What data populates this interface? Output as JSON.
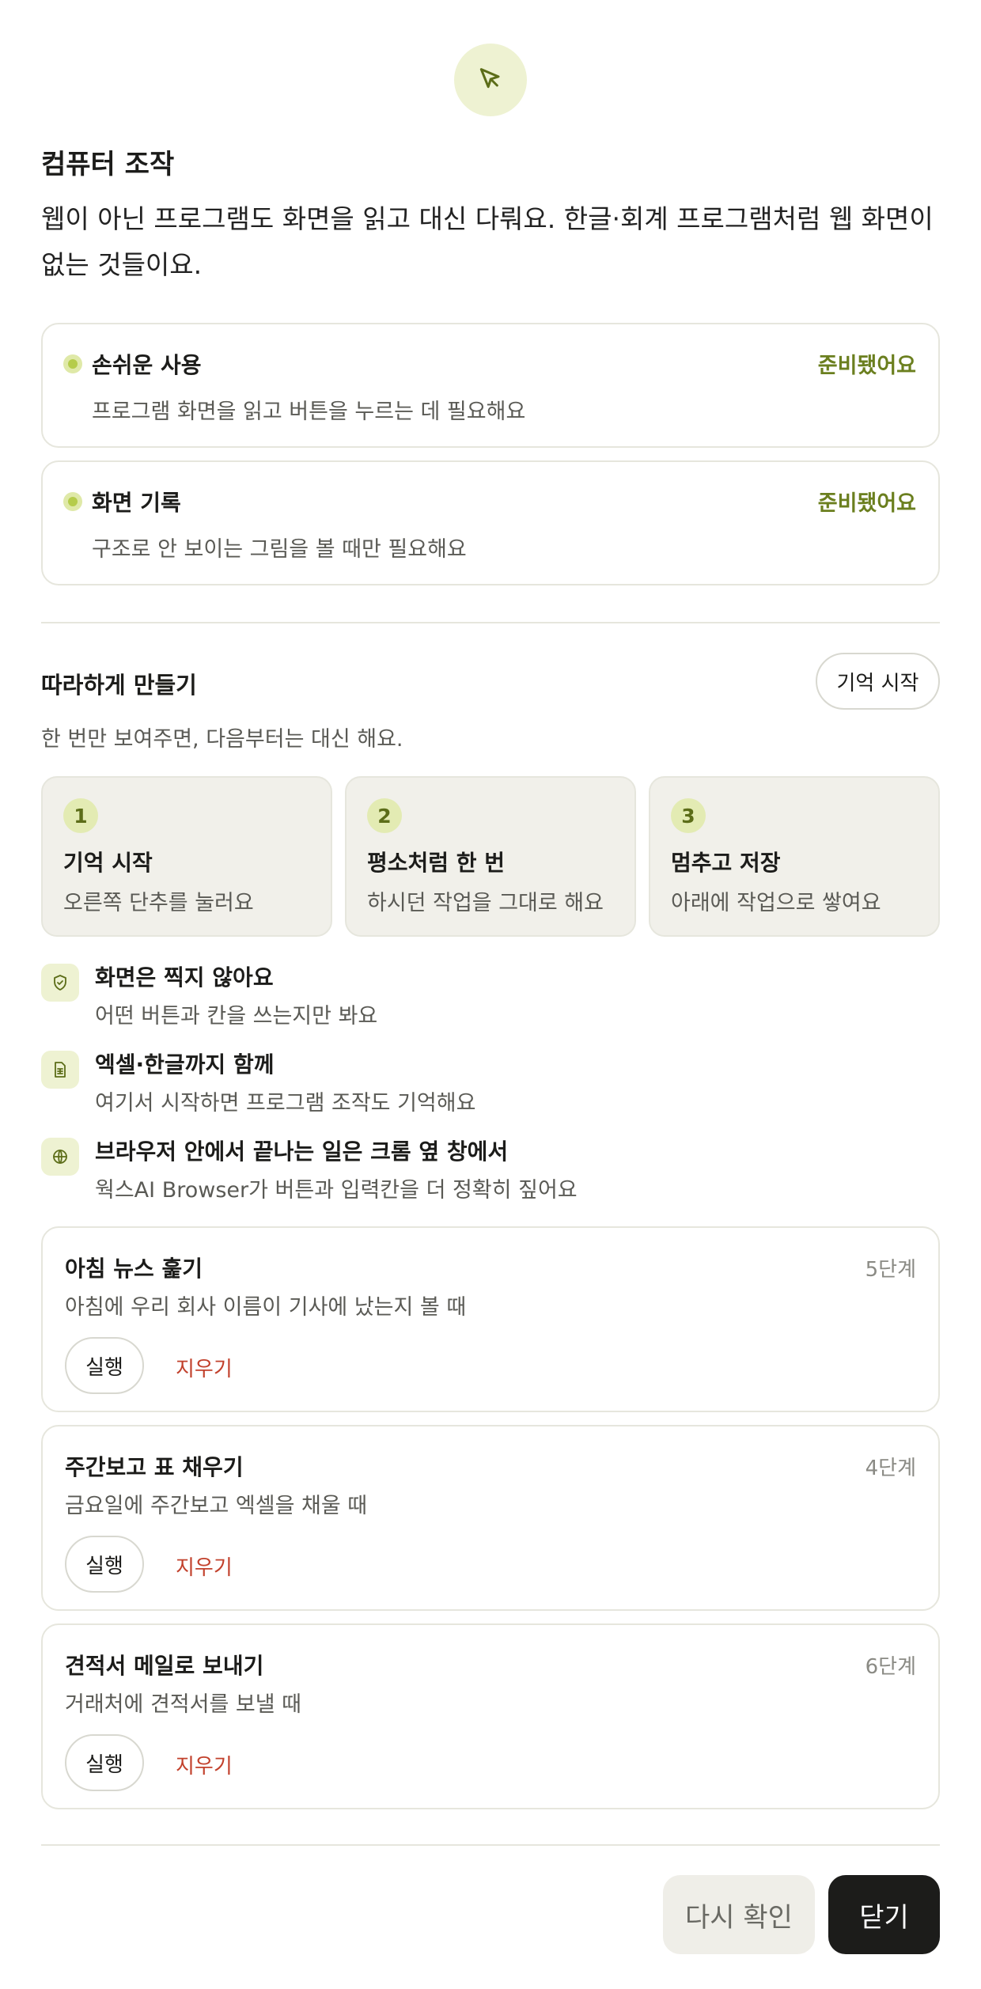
{
  "header": {
    "icon": "cursor-arrow-icon",
    "title": "컴퓨터 조작",
    "description": "웹이 아닌 프로그램도 화면을 읽고 대신 다뤄요. 한글·회계 프로그램처럼 웹 화면이 없는 것들이요."
  },
  "permissions": [
    {
      "name": "손쉬운 사용",
      "status": "준비됐어요",
      "description": "프로그램 화면을 읽고 버튼을 누르는 데 필요해요"
    },
    {
      "name": "화면 기록",
      "status": "준비됐어요",
      "description": "구조로 안 보이는 그림을 볼 때만 필요해요"
    }
  ],
  "teach": {
    "title": "따라하게 만들기",
    "start_button": "기억 시작",
    "subtitle": "한 번만 보여주면, 다음부터는 대신 해요.",
    "steps": [
      {
        "number": "1",
        "title": "기억 시작",
        "description": "오른쪽 단추를 눌러요"
      },
      {
        "number": "2",
        "title": "평소처럼 한 번",
        "description": "하시던 작업을 그대로 해요"
      },
      {
        "number": "3",
        "title": "멈추고 저장",
        "description": "아래에 작업으로 쌓여요"
      }
    ]
  },
  "notes": [
    {
      "icon": "shield-check-icon",
      "title": "화면은 찍지 않아요",
      "description": "어떤 버튼과 칸을 쓰는지만 봐요"
    },
    {
      "icon": "spreadsheet-icon",
      "title": "엑셀·한글까지 함께",
      "description": "여기서 시작하면 프로그램 조작도 기억해요"
    },
    {
      "icon": "globe-icon",
      "title": "브라우저 안에서 끝나는 일은 크롬 옆 창에서",
      "description": "웍스AI Browser가 버튼과 입력칸을 더 정확히 짚어요"
    }
  ],
  "routines": [
    {
      "title": "아침 뉴스 훑기",
      "steps": "5단계",
      "description": "아침에 우리 회사 이름이 기사에 났는지 볼 때",
      "run": "실행",
      "delete": "지우기"
    },
    {
      "title": "주간보고 표 채우기",
      "steps": "4단계",
      "description": "금요일에 주간보고 엑셀을 채울 때",
      "run": "실행",
      "delete": "지우기"
    },
    {
      "title": "견적서 메일로 보내기",
      "steps": "6단계",
      "description": "거래처에 견적서를 보낼 때",
      "run": "실행",
      "delete": "지우기"
    }
  ],
  "footer": {
    "recheck_button": "다시 확인",
    "close_button": "닫기"
  },
  "colors": {
    "accent_green": "#6b7f1f",
    "status_dot": "#b5cc4b",
    "danger": "#c2412c",
    "primary_button": "#1c1c1a"
  }
}
